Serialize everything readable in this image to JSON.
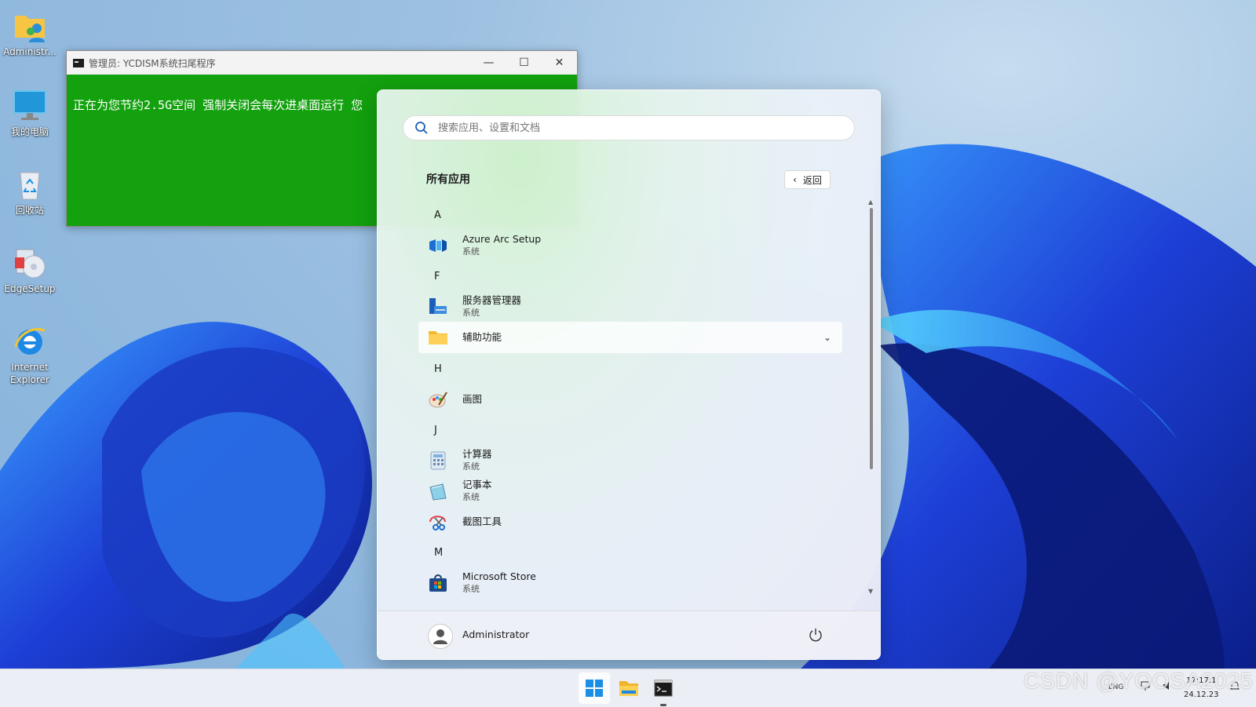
{
  "desktop_icons": [
    {
      "label": "Administr...",
      "icon": "user-folder-icon"
    },
    {
      "label": "我的电脑",
      "icon": "computer-icon"
    },
    {
      "label": "回收站",
      "icon": "recycle-bin-icon"
    },
    {
      "label": "EdgeSetup",
      "icon": "setup-icon"
    },
    {
      "label": "Internet\nExplorer",
      "icon": "internet-explorer-icon"
    }
  ],
  "console": {
    "title": "管理员:  YCDISM系统扫尾程序",
    "text": "正在为您节约2.5G空间 强制关闭会每次进桌面运行 您",
    "bg_color": "#13a10e"
  },
  "start_menu": {
    "search_placeholder": "搜索应用、设置和文档",
    "section_title": "所有应用",
    "back_label": "返回",
    "groups": [
      {
        "letter": "A",
        "apps": [
          {
            "name": "Azure Arc Setup",
            "sub": "系统",
            "icon": "azure-arc-icon"
          }
        ]
      },
      {
        "letter": "F",
        "apps": [
          {
            "name": "服务器管理器",
            "sub": "系统",
            "icon": "server-manager-icon"
          },
          {
            "name": "辅助功能",
            "sub": "",
            "icon": "folder-icon",
            "folder": true
          }
        ]
      },
      {
        "letter": "H",
        "apps": [
          {
            "name": "画图",
            "sub": "",
            "icon": "paint-icon"
          }
        ]
      },
      {
        "letter": "J",
        "apps": [
          {
            "name": "计算器",
            "sub": "系统",
            "icon": "calculator-icon"
          },
          {
            "name": "记事本",
            "sub": "系统",
            "icon": "notepad-icon"
          },
          {
            "name": "截图工具",
            "sub": "",
            "icon": "snipping-tool-icon"
          }
        ]
      },
      {
        "letter": "M",
        "apps": [
          {
            "name": "Microsoft Store",
            "sub": "系统",
            "icon": "store-icon"
          }
        ]
      }
    ],
    "user": "Administrator"
  },
  "taskbar": {
    "items": [
      "start-icon",
      "file-explorer-icon",
      "cmd-icon"
    ],
    "lang": "ENG",
    "time": "17:17:1",
    "date": "24.12.23"
  },
  "watermark": "CSDN @YOOSA2025"
}
